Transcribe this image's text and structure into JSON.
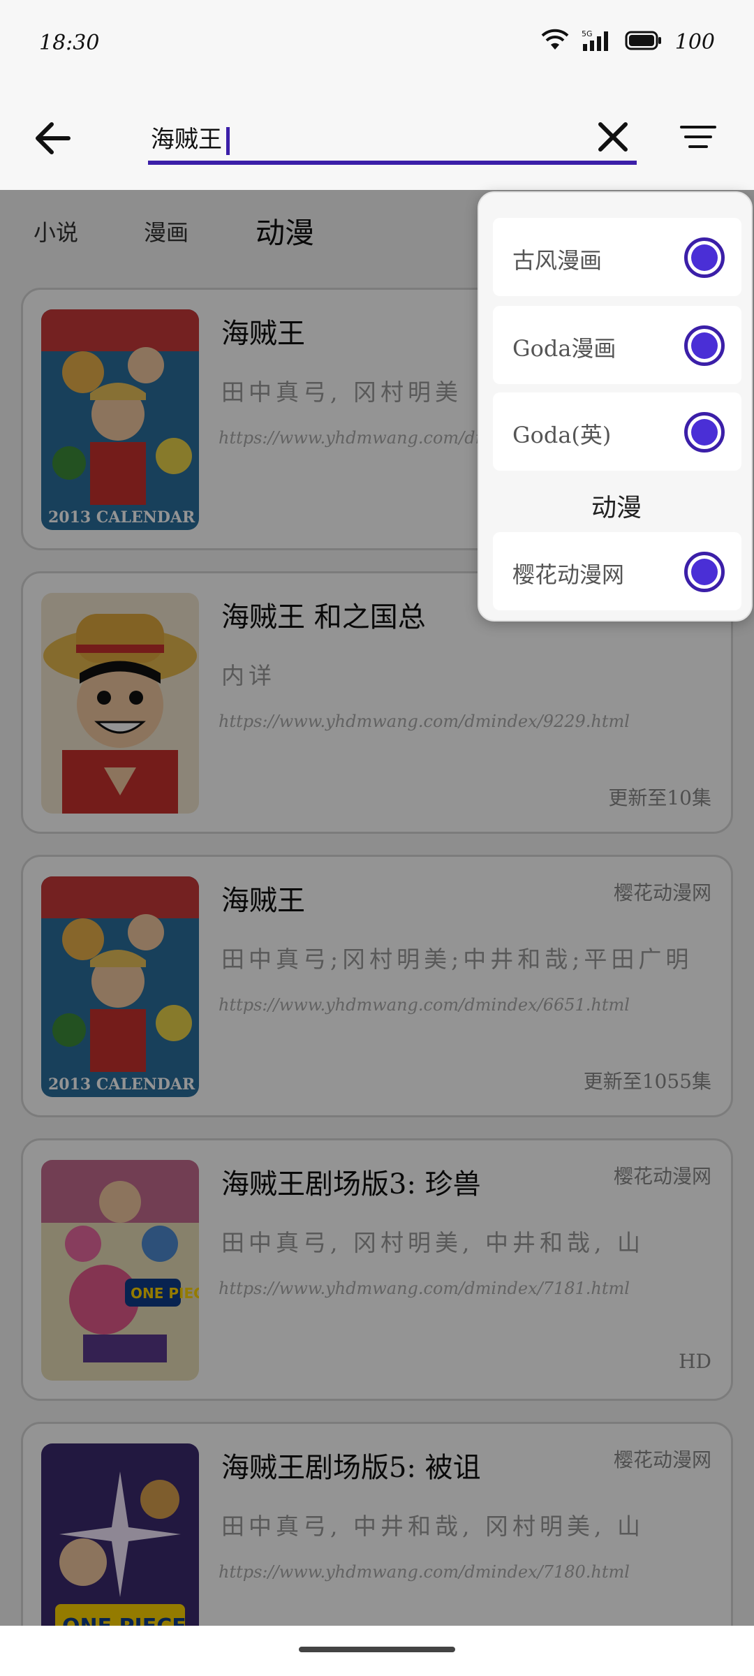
{
  "status_bar": {
    "time": "18:30",
    "battery": "100",
    "network": "5G"
  },
  "search": {
    "query": "海贼王"
  },
  "tabs": [
    "小说",
    "漫画",
    "动漫"
  ],
  "active_tab": "动漫",
  "results": [
    {
      "title": "海贼王",
      "source": "",
      "author": "田中真弓, 冈村明美",
      "url": "https://www.yhdmwang.com/dmin",
      "status": ""
    },
    {
      "title": "海贼王 和之国总",
      "source": "",
      "author": "内详",
      "url": "https://www.yhdmwang.com/dmindex/9229.html",
      "status": "更新至10集"
    },
    {
      "title": "海贼王",
      "source": "樱花动漫网",
      "author": "田中真弓;冈村明美;中井和哉;平田广明",
      "url": "https://www.yhdmwang.com/dmindex/6651.html",
      "status": "更新至1055集"
    },
    {
      "title": "海贼王剧场版3: 珍兽",
      "source": "樱花动漫网",
      "author": "田中真弓, 冈村明美, 中井和哉, 山",
      "url": "https://www.yhdmwang.com/dmindex/7181.html",
      "status": "HD"
    },
    {
      "title": "海贼王剧场版5: 被诅",
      "source": "樱花动漫网",
      "author": "田中真弓, 中井和哉, 冈村明美, 山",
      "url": "https://www.yhdmwang.com/dmindex/7180.html",
      "status": ""
    }
  ],
  "popup": {
    "items_top": [
      "古风漫画",
      "Goda漫画",
      "Goda(英)"
    ],
    "section": "动漫",
    "items_bottom": [
      "樱花动漫网"
    ]
  },
  "colors": {
    "accent": "#3b1fa8",
    "radio": "#4a2fd6"
  }
}
